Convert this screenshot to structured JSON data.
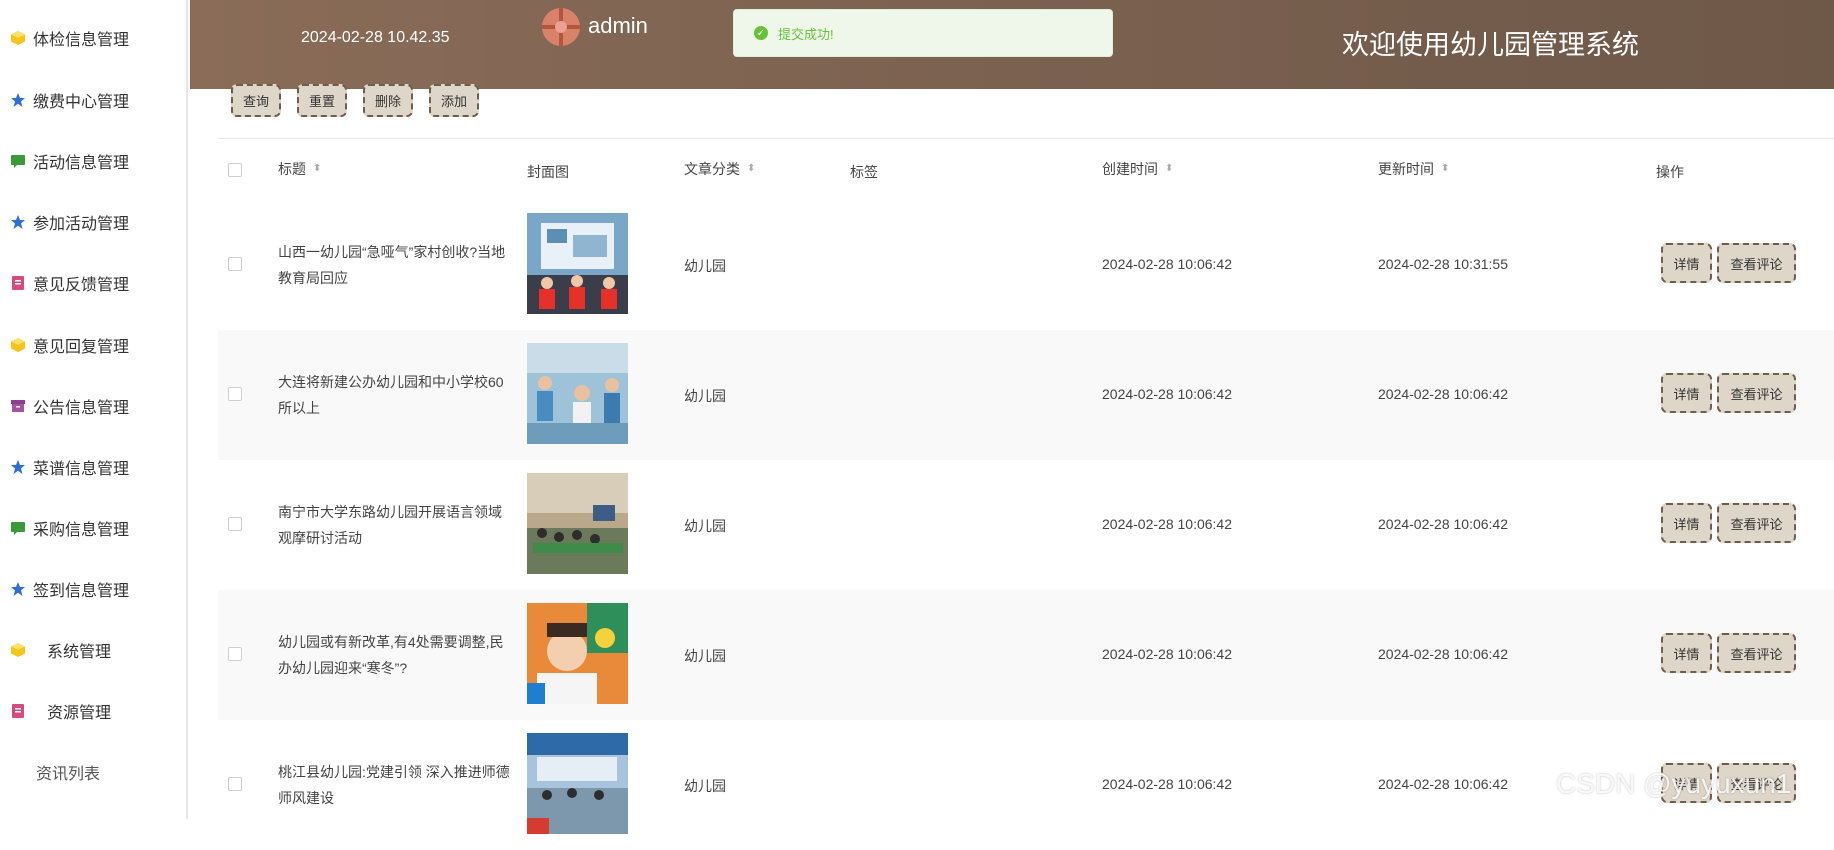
{
  "sidebar": {
    "items": [
      {
        "label": "体检信息管理",
        "icon": "cube-icon"
      },
      {
        "label": "缴费中心管理",
        "icon": "star-icon"
      },
      {
        "label": "活动信息管理",
        "icon": "chat-icon"
      },
      {
        "label": "参加活动管理",
        "icon": "star-icon"
      },
      {
        "label": "意见反馈管理",
        "icon": "document-icon"
      },
      {
        "label": "意见回复管理",
        "icon": "cube-icon"
      },
      {
        "label": "公告信息管理",
        "icon": "archive-icon"
      },
      {
        "label": "菜谱信息管理",
        "icon": "star-icon"
      },
      {
        "label": "采购信息管理",
        "icon": "chat-icon"
      },
      {
        "label": "签到信息管理",
        "icon": "star-icon"
      },
      {
        "label": "系统管理",
        "icon": "cube-icon"
      },
      {
        "label": "资源管理",
        "icon": "document-icon"
      },
      {
        "label": "资讯列表",
        "icon": ""
      }
    ]
  },
  "header": {
    "datetime": "2024-02-28 10.42.35",
    "username": "admin",
    "title": "欢迎使用幼儿园管理系统"
  },
  "toast": {
    "message": "提交成功!"
  },
  "toolbar": {
    "query": "查询",
    "reset": "重置",
    "delete": "删除",
    "add": "添加"
  },
  "table": {
    "columns": {
      "title": "标题",
      "cover": "封面图",
      "category": "文章分类",
      "tags": "标签",
      "created": "创建时间",
      "updated": "更新时间",
      "actions": "操作"
    },
    "rows": [
      {
        "title": "山西一幼儿园“急哑气”家村创收?当地教育局回应",
        "category": "幼儿园",
        "tags": "",
        "created": "2024-02-28 10:06:42",
        "updated": "2024-02-28 10:31:55"
      },
      {
        "title": "大连将新建公办幼儿园和中小学校60所以上",
        "category": "幼儿园",
        "tags": "",
        "created": "2024-02-28 10:06:42",
        "updated": "2024-02-28 10:06:42"
      },
      {
        "title": "南宁市大学东路幼儿园开展语言领域观摩研讨活动",
        "category": "幼儿园",
        "tags": "",
        "created": "2024-02-28 10:06:42",
        "updated": "2024-02-28 10:06:42"
      },
      {
        "title": "幼儿园或有新改革,有4处需要调整,民办幼儿园迎来“寒冬”?",
        "category": "幼儿园",
        "tags": "",
        "created": "2024-02-28 10:06:42",
        "updated": "2024-02-28 10:06:42"
      },
      {
        "title": "桃江县幼儿园:党建引领 深入推进师德师风建设",
        "category": "幼儿园",
        "tags": "",
        "created": "2024-02-28 10:06:42",
        "updated": "2024-02-28 10:06:42"
      }
    ],
    "detail_label": "详情",
    "comment_label": "查看评论"
  },
  "watermark": "CSDN @yuyuxun1",
  "colors": {
    "header_bg": "#7b6150",
    "button_bg": "#ded6c9",
    "button_border": "#6f5d4e",
    "toast_green": "#67c23a"
  }
}
